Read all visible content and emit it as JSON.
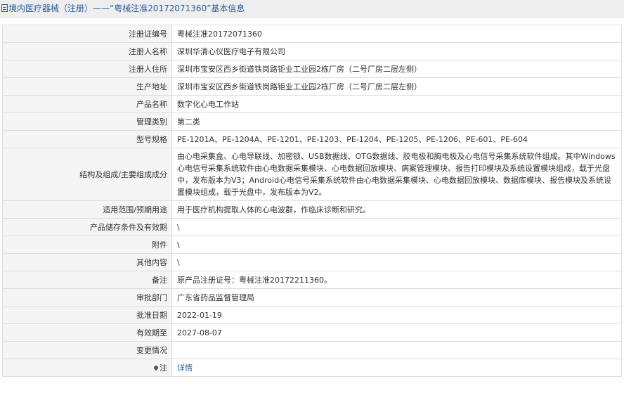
{
  "header": {
    "title": "境内医疗器械（注册）——“粤械注准20172071360”基本信息"
  },
  "rows": [
    {
      "label": "注册证编号",
      "value": "粤械注准20172071360"
    },
    {
      "label": "注册人名称",
      "value": "深圳华清心仪医疗电子有限公司"
    },
    {
      "label": "注册人住所",
      "value": "深圳市宝安区西乡街道铁岗路钜业工业园2栋厂房（二号厂房二层左侧）"
    },
    {
      "label": "生产地址",
      "value": "深圳市宝安区西乡街道铁岗路钜业工业园2栋厂房（二号厂房二层左侧）"
    },
    {
      "label": "产品名称",
      "value": "数字化心电工作站"
    },
    {
      "label": "管理类别",
      "value": "第二类"
    },
    {
      "label": "型号规格",
      "value": "PE-1201A、PE-1204A、PE-1201、PE-1203、PE-1204、PE-1205、PE-1206、PE-601、PE-604"
    },
    {
      "label": "结构及组成/主要组成成分",
      "value": "由心电采集盒、心电导联线、加密锁、USB数据线、OTG数据线、胶电极和胸电极及心电信号采集系统软件组成。其中Windows心电信号采集系统软件由心电数据采集模块、心电数据回放模块、病案管理模块、报告打印模块及系统设置模块组成，载于光盘中，发布版本为V3；Android心电信号采集系统软件由心电数据采集模块、心电数据回放模块、数据库模块、报告模块及系统设置模块组成，载于光盘中，发布版本为V2。"
    },
    {
      "label": "适用范围/预期用途",
      "value": "用于医疗机构提取人体的心电波群，作临床诊断和研究。"
    },
    {
      "label": "产品储存条件及有效期",
      "value": "\\"
    },
    {
      "label": "附件",
      "value": "\\"
    },
    {
      "label": "其他内容",
      "value": "\\"
    },
    {
      "label": "备注",
      "value": "原产品注册证号：粤械注准20172211360。"
    },
    {
      "label": "审批部门",
      "value": "广东省药品监督管理局"
    },
    {
      "label": "批准日期",
      "value": "2022-01-19"
    },
    {
      "label": "有效期至",
      "value": "2027-08-07"
    },
    {
      "label": "变更情况",
      "value": ""
    },
    {
      "label": "注",
      "value": "详情"
    }
  ]
}
